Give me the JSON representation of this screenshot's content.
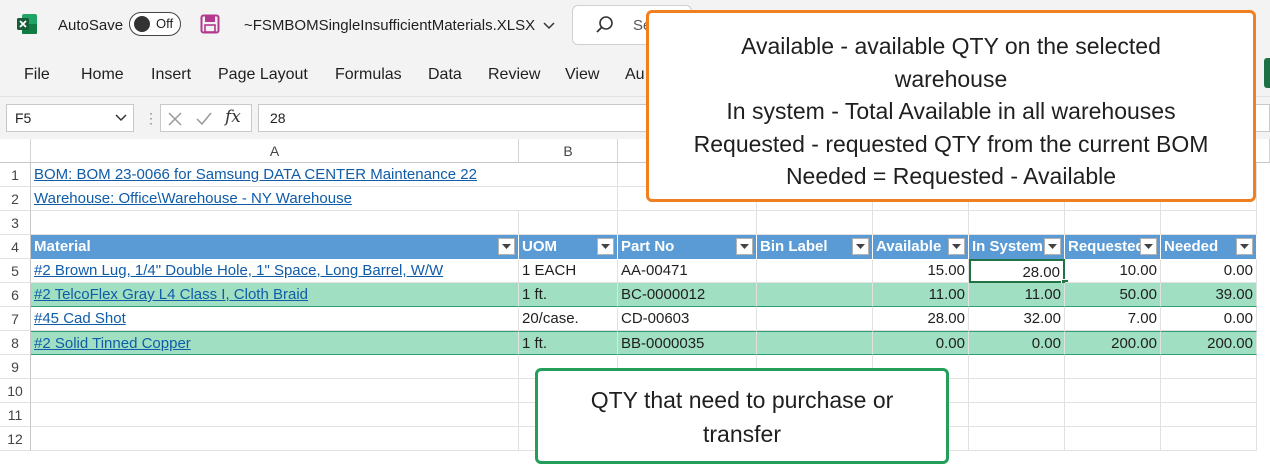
{
  "titlebar": {
    "autosave_label": "AutoSave",
    "toggle_state": "Off",
    "filename": "~FSMBOMSingleInsufficientMaterials.XLSX",
    "search_placeholder": "Se"
  },
  "menu": [
    "File",
    "Home",
    "Insert",
    "Page Layout",
    "Formulas",
    "Data",
    "Review",
    "View",
    "Au"
  ],
  "formula_bar": {
    "name_box": "F5",
    "fx": "fx",
    "formula": "28"
  },
  "columns": {
    "A": "A",
    "B": "B"
  },
  "rows": [
    "1",
    "2",
    "3",
    "4",
    "5",
    "6",
    "7",
    "8",
    "9",
    "10",
    "11",
    "12"
  ],
  "sheet": {
    "line1": "BOM: BOM 23-0066 for Samsung DATA CENTER Maintenance 22",
    "line2": "Warehouse: Office\\Warehouse - NY Warehouse",
    "table_headers": [
      "Material",
      "UOM",
      "Part No",
      "Bin Label",
      "Available",
      "In System",
      "Requested",
      "Needed"
    ],
    "table_rows": [
      [
        "#2 Brown Lug, 1/4\" Double Hole, 1\" Space, Long Barrel, W/W",
        "1 EACH",
        "AA-00471",
        "",
        "15.00",
        "28.00",
        "10.00",
        "0.00"
      ],
      [
        "#2 TelcoFlex Gray L4 Class I, Cloth Braid",
        "1 ft.",
        "BC-0000012",
        "",
        "11.00",
        "11.00",
        "50.00",
        "39.00"
      ],
      [
        "#45 Cad Shot",
        "20/case.",
        "CD-00603",
        "",
        "28.00",
        "32.00",
        "7.00",
        "0.00"
      ],
      [
        "#2 Solid Tinned Copper",
        "1 ft.",
        "BB-0000035",
        "",
        "0.00",
        "0.00",
        "200.00",
        "200.00"
      ]
    ]
  },
  "callouts": {
    "top": [
      "Available - available QTY on the selected",
      "warehouse",
      "In system - Total Available in all warehouses",
      "Requested - requested QTY from the current BOM",
      "Needed = Requested - Available"
    ],
    "bottom": [
      "QTY that need to purchase or",
      "transfer"
    ]
  },
  "colors": {
    "excel_green": "#217346",
    "header_blue": "#5b9bd5",
    "band_green": "#a0dfc2",
    "callout_orange": "#f0801f",
    "callout_green": "#22a05a",
    "link_blue": "#0f5ca8"
  }
}
